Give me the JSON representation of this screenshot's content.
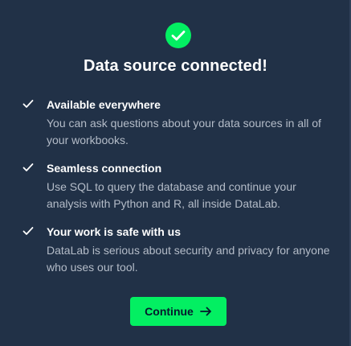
{
  "colors": {
    "background": "#213147",
    "accent": "#03ef62",
    "title": "#ffffff",
    "description": "#b4bcc8",
    "button_text": "#05192d"
  },
  "header": {
    "icon": "check-circle-icon",
    "title": "Data source connected!"
  },
  "features": [
    {
      "icon": "check-icon",
      "title": "Available everywhere",
      "description": "You can ask questions about your data sources in all of your workbooks."
    },
    {
      "icon": "check-icon",
      "title": "Seamless connection",
      "description": "Use SQL to query the database and continue your analysis with Python and R, all inside DataLab."
    },
    {
      "icon": "check-icon",
      "title": "Your work is safe with us",
      "description": "DataLab is serious about security and privacy for anyone who uses our tool."
    }
  ],
  "footer": {
    "continue_label": "Continue",
    "continue_icon": "arrow-right-icon"
  }
}
